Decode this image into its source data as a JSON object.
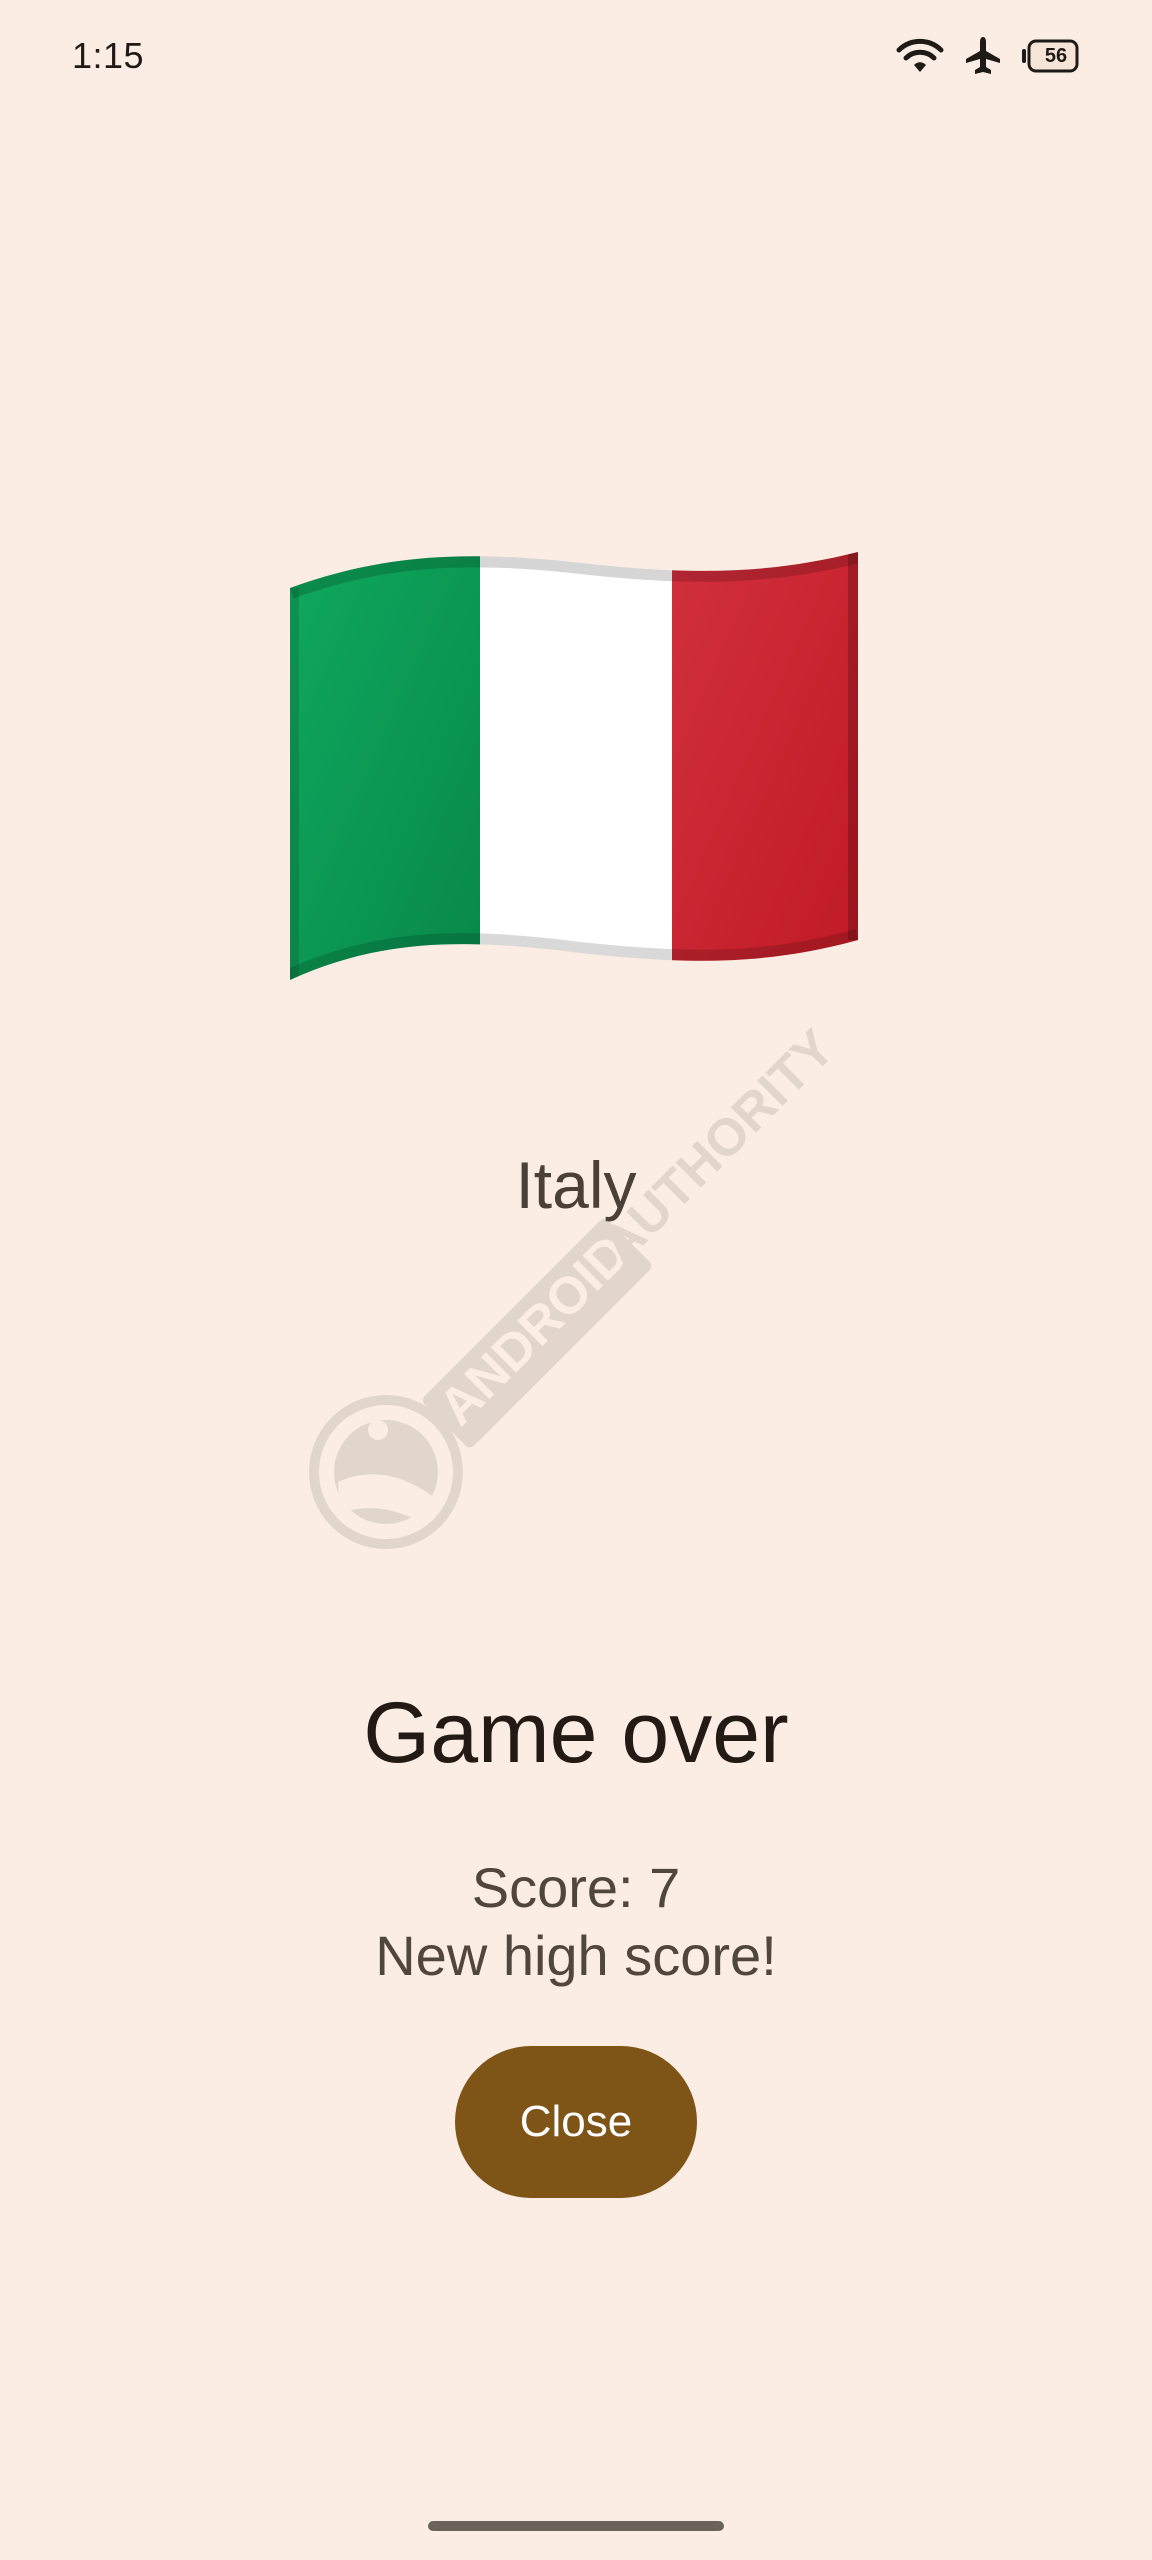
{
  "status_bar": {
    "time": "1:15",
    "battery_level": "56",
    "icons": [
      "wifi-icon",
      "airplane-mode-icon",
      "battery-icon"
    ]
  },
  "game": {
    "flag_icon": "italy-flag-icon",
    "country": "Italy",
    "title": "Game over",
    "score": "Score: 7",
    "message": "New high score!",
    "close_label": "Close"
  },
  "watermark": {
    "text": "ANDROID AUTHORITY"
  },
  "colors": {
    "background": "#fbede3",
    "button": "#7e5417",
    "flag_green": "#0c9f55",
    "flag_white": "#ffffff",
    "flag_red": "#ce2532"
  }
}
